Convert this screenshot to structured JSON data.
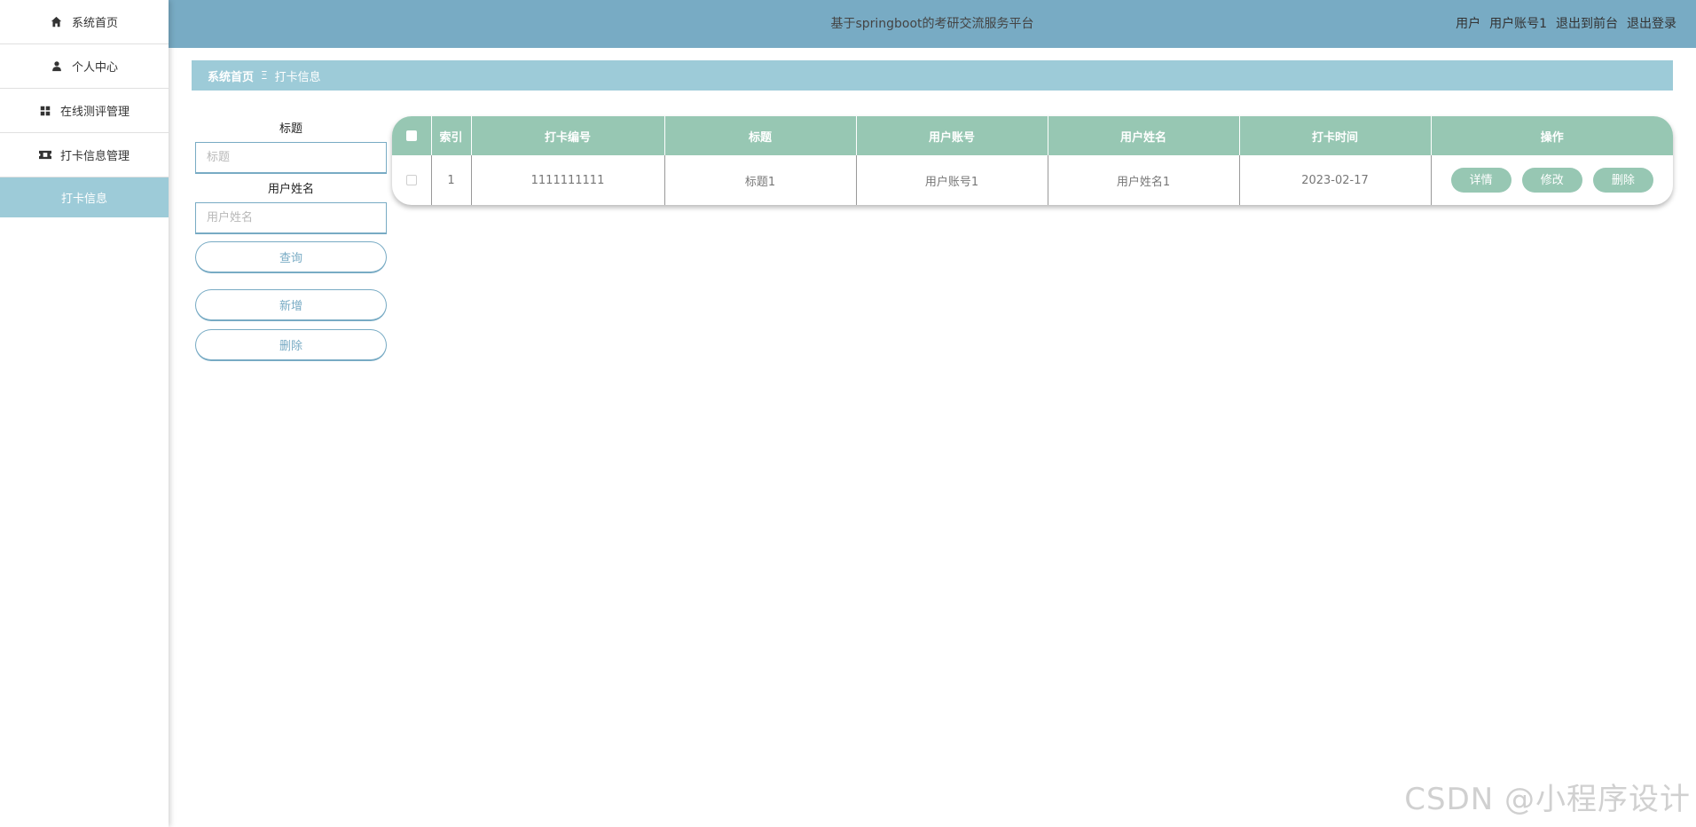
{
  "sidebar": {
    "items": [
      {
        "label": "系统首页",
        "icon": "home-icon"
      },
      {
        "label": "个人中心",
        "icon": "user-icon"
      },
      {
        "label": "在线测评管理",
        "icon": "grid-icon"
      },
      {
        "label": "打卡信息管理",
        "icon": "ticket-icon"
      },
      {
        "label": "打卡信息",
        "icon": "",
        "active": true
      }
    ]
  },
  "header": {
    "title": "基于springboot的考研交流服务平台",
    "role": "用户",
    "account": "用户账号1",
    "exit_front": "退出到前台",
    "logout": "退出登录",
    "bg_color": "#78abc4"
  },
  "breadcrumb": {
    "home": "系统首页",
    "separator": "Ξ",
    "current": "打卡信息"
  },
  "search": {
    "title_label": "标题",
    "title_placeholder": "标题",
    "name_label": "用户姓名",
    "name_placeholder": "用户姓名",
    "query_button": "查询",
    "add_button": "新增",
    "delete_button": "删除"
  },
  "table": {
    "columns": [
      "索引",
      "打卡编号",
      "标题",
      "用户账号",
      "用户姓名",
      "打卡时间",
      "操作"
    ],
    "rows": [
      {
        "index": "1",
        "code": "1111111111",
        "title": "标题1",
        "account": "用户账号1",
        "name": "用户姓名1",
        "time": "2023-02-17"
      }
    ],
    "actions": {
      "detail": "详情",
      "edit": "修改",
      "delete": "删除"
    },
    "header_color": "#97c7b3"
  },
  "watermark": "CSDN @小程序设计"
}
